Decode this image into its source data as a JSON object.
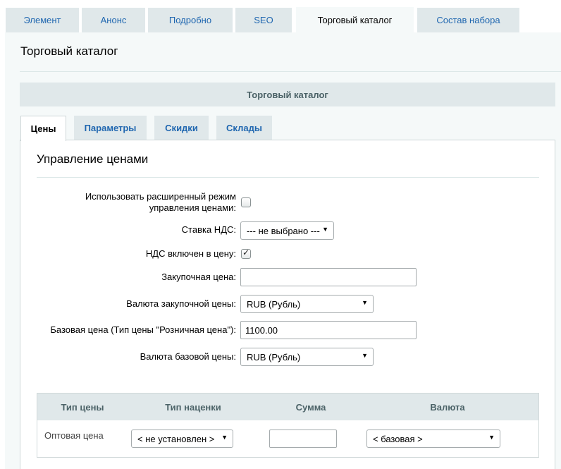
{
  "top_tabs": [
    {
      "label": "Элемент"
    },
    {
      "label": "Анонс"
    },
    {
      "label": "Подробно"
    },
    {
      "label": "SEO"
    },
    {
      "label": "Торговый каталог",
      "active": true
    },
    {
      "label": "Состав набора"
    }
  ],
  "panel": {
    "title": "Торговый каталог",
    "section_header": "Торговый каталог"
  },
  "sub_tabs": [
    {
      "label": "Цены",
      "active": true
    },
    {
      "label": "Параметры"
    },
    {
      "label": "Скидки"
    },
    {
      "label": "Склады"
    }
  ],
  "prices": {
    "title": "Управление ценами",
    "advanced_mode": {
      "label_line1": "Использовать расширенный режим",
      "label_line2": "управления ценами:",
      "checked": false
    },
    "vat_rate": {
      "label": "Ставка НДС:",
      "value": "--- не выбрано ---"
    },
    "vat_included": {
      "label": "НДС включен в цену:",
      "checked": true
    },
    "purchase_price": {
      "label": "Закупочная цена:",
      "value": ""
    },
    "purchase_currency": {
      "label": "Валюта закупочной цены:",
      "value": "RUB (Рубль)"
    },
    "base_price": {
      "label": "Базовая цена (Тип цены \"Розничная цена\"):",
      "value": "1100.00"
    },
    "base_currency": {
      "label": "Валюта базовой цены:",
      "value": "RUB (Рубль)"
    }
  },
  "price_table": {
    "headers": [
      "Тип цены",
      "Тип наценки",
      "Сумма",
      "Валюта"
    ],
    "rows": [
      {
        "type": "Оптовая цена",
        "markup": "< не установлен >",
        "amount": "",
        "currency": "< базовая >"
      }
    ]
  },
  "colors": {
    "accent_link": "#2067b0",
    "tab_bg": "#e0e8ea",
    "panel_bg": "#f5f9f9"
  }
}
